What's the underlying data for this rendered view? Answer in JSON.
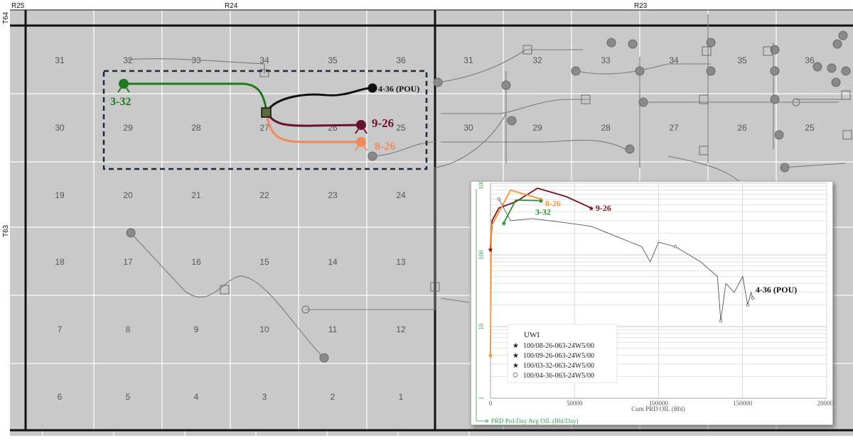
{
  "map": {
    "range_labels": [
      "R25",
      "R24",
      "R23"
    ],
    "township_labels": [
      "T64",
      "T63"
    ],
    "sections": {
      "row1_left": [
        "31",
        "32",
        "33",
        "34",
        "35",
        "36"
      ],
      "row2_left": [
        "30",
        "29",
        "28",
        "27",
        "26",
        "25"
      ],
      "row3_left": [
        "19",
        "20",
        "21",
        "22",
        "23",
        "24"
      ],
      "row4_left": [
        "18",
        "17",
        "16",
        "15",
        "14",
        "13"
      ],
      "row5_left": [
        "7",
        "8",
        "9",
        "10",
        "11",
        "12"
      ],
      "row6_left": [
        "6",
        "5",
        "4",
        "3",
        "2",
        "1"
      ],
      "row1_right": [
        "31",
        "32",
        "33",
        "34",
        "35",
        "36"
      ],
      "row2_right": [
        "30",
        "29",
        "28",
        "27",
        "26",
        "25"
      ]
    },
    "wells": [
      {
        "label": "3-32",
        "color": "#1f7a1f"
      },
      {
        "label": "4-36 (POU)",
        "color": "#111111"
      },
      {
        "label": "9-26",
        "color": "#6b1034"
      },
      {
        "label": "8-26",
        "color": "#f08a5d"
      }
    ]
  },
  "chart_data": {
    "type": "scatter",
    "xlabel": "Cum PRD OIL (Bbl)",
    "ylabel": "PRD Prd-Day Avg OIL (Bbl/Day)",
    "xlim": [
      0,
      200000
    ],
    "ylim": [
      1,
      1000
    ],
    "yscale": "log",
    "x_ticks": [
      "0",
      "50000",
      "100000",
      "150000",
      "200000"
    ],
    "y_ticks": [
      "1000",
      "100",
      "10",
      "1"
    ],
    "grid": true,
    "legend_title": "UWI",
    "legend_position": "bottom-left",
    "series": [
      {
        "name": "100/08-26-063-24W5/00",
        "label": "8-26",
        "color": "#f5922f",
        "marker": "star",
        "x": [
          0,
          500,
          12000,
          30000
        ],
        "y": [
          4,
          250,
          800,
          600
        ]
      },
      {
        "name": "100/09-26-063-24W5/00",
        "label": "9-26",
        "color": "#7a1020",
        "marker": "star",
        "x": [
          0,
          1000,
          5000,
          15000,
          28000,
          45000,
          60000
        ],
        "y": [
          120,
          300,
          450,
          550,
          850,
          650,
          450
        ]
      },
      {
        "name": "100/03-32-063-24W5/00",
        "label": "3-32",
        "color": "#2e8b2e",
        "marker": "star",
        "x": [
          8000,
          15000,
          30000
        ],
        "y": [
          280,
          580,
          570
        ]
      },
      {
        "name": "100/04-36-063-24W5/00",
        "label": "4-36 (POU)",
        "color": "#555555",
        "marker": "circle",
        "x": [
          5000,
          12000,
          25000,
          45000,
          60000,
          75000,
          90000,
          95000,
          100000,
          110000,
          125000,
          135000,
          137000,
          140000,
          145000,
          150000,
          153000,
          155000,
          156000
        ],
        "y": [
          600,
          300,
          320,
          280,
          250,
          180,
          130,
          80,
          150,
          130,
          80,
          50,
          12,
          40,
          30,
          50,
          20,
          30,
          25
        ]
      }
    ]
  }
}
